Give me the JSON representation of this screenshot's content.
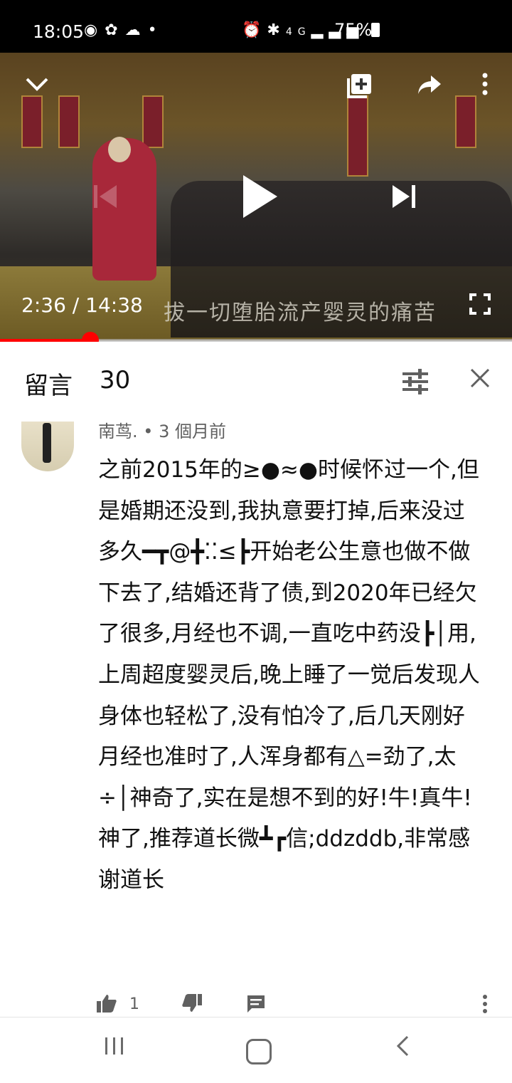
{
  "status_bar": {
    "time": "18:05",
    "left_icons": [
      "line-app-icon",
      "pinwheel-icon",
      "cloud-icon",
      "dot-icon"
    ],
    "right_icons": [
      "alarm-icon",
      "bluetooth-icon",
      "4g-signal-icon"
    ],
    "battery": "75%"
  },
  "player": {
    "subtitle_text": "拔一切堕胎流产婴灵的痛苦",
    "current_time": "2:36",
    "separator": "/",
    "duration": "14:38",
    "progress_fraction": 0.177,
    "accent_color": "#ff0000"
  },
  "comments_header": {
    "title": "留言",
    "count": "30"
  },
  "comment": {
    "author": "南茑.",
    "bullet": "•",
    "age": "3 個月前",
    "text": "之前2015年的≥●≈●时候怀过一个,但是婚期还没到,我执意要打掉,后来没过多久━┳@╋⁚⁚≤┣开始老公生意也做不做下去了,结婚还背了债,到2020年已经欠了很多,月经也不调,一直吃中药没┣│用,上周超度婴灵后,晚上睡了一觉后发现人身体也轻松了,没有怕冷了,后几天刚好月经也准时了,人浑身都有△=劲了,太÷│神奇了,实在是想不到的好!牛!真牛!神了,推荐道长微┻┏信;ddzddb,非常感谢道长",
    "like_count": "1"
  }
}
